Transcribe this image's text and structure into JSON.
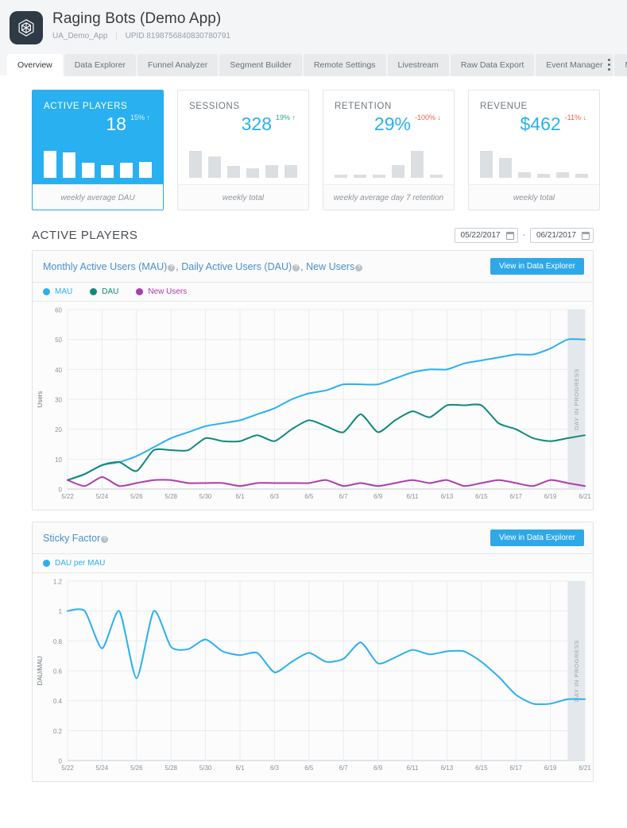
{
  "header": {
    "app_title": "Raging Bots (Demo App)",
    "app_slug": "UA_Demo_App",
    "upid": "UPID 8198756840830780791",
    "logo_icon": "unity-logo-icon",
    "overflow_icon": "kebab-menu-icon"
  },
  "tabs": [
    {
      "label": "Overview",
      "active": true
    },
    {
      "label": "Data Explorer",
      "active": false
    },
    {
      "label": "Funnel Analyzer",
      "active": false
    },
    {
      "label": "Segment Builder",
      "active": false
    },
    {
      "label": "Remote Settings",
      "active": false
    },
    {
      "label": "Livestream",
      "active": false
    },
    {
      "label": "Raw Data Export",
      "active": false
    },
    {
      "label": "Event Manager",
      "active": false
    },
    {
      "label": "More",
      "active": false,
      "caret": "⌄"
    }
  ],
  "kpi_cards": [
    {
      "label": "ACTIVE PLAYERS",
      "value": "18",
      "delta": "15%",
      "delta_dir": "up",
      "arrow": "↑",
      "footer": "weekly average DAU",
      "selected": true,
      "spark": [
        30,
        28,
        17,
        14,
        17,
        18
      ]
    },
    {
      "label": "SESSIONS",
      "value": "328",
      "delta": "19%",
      "delta_dir": "up",
      "arrow": "↑",
      "footer": "weekly total",
      "selected": false,
      "spark": [
        30,
        24,
        13,
        11,
        14,
        14
      ]
    },
    {
      "label": "RETENTION",
      "value": "29%",
      "delta": "-100%",
      "delta_dir": "down",
      "arrow": "↓",
      "footer": "weekly average day 7 retention",
      "selected": false,
      "spark": [
        2,
        2,
        2,
        9,
        19,
        2
      ]
    },
    {
      "label": "REVENUE",
      "value": "$462",
      "delta": "-11%",
      "delta_dir": "down",
      "arrow": "↓",
      "footer": "weekly total",
      "selected": false,
      "spark": [
        26,
        19,
        5,
        4,
        5,
        4
      ]
    }
  ],
  "section": {
    "title": "ACTIVE PLAYERS",
    "date_start": "05/22/2017",
    "date_end": "06/21/2017",
    "date_separator": "-",
    "calendar_icon": "calendar-icon"
  },
  "panels": [
    {
      "title_parts": [
        "Monthly Active Users (MAU)",
        ", Daily Active Users (DAU)",
        ", New Users"
      ],
      "title_plain": "Monthly Active Users (MAU), Daily Active Users (DAU), New Users",
      "button": "View in Data Explorer",
      "in_progress_label": "DAY IN PROGRESS"
    },
    {
      "title_parts": [
        "Sticky Factor"
      ],
      "title_plain": "Sticky Factor",
      "button": "View in Data Explorer",
      "in_progress_label": "DAY IN PROGRESS"
    }
  ],
  "colors": {
    "mau": "#29b0f1",
    "dau": "#0e8a79",
    "new_users": "#ad3cad",
    "accent": "#2fa8e8",
    "up": "#2aa98c",
    "down": "#f0614a"
  },
  "chart_data": [
    {
      "type": "line",
      "title": "Monthly Active Users (MAU), Daily Active Users (DAU), New Users",
      "xlabel": "",
      "ylabel": "Users",
      "ylim": [
        0,
        60
      ],
      "yticks": [
        0,
        10,
        20,
        30,
        40,
        50,
        60
      ],
      "grid": true,
      "legend_position": "top-left",
      "x": [
        "5/22",
        "5/23",
        "5/24",
        "5/25",
        "5/26",
        "5/27",
        "5/28",
        "5/29",
        "5/30",
        "5/31",
        "6/1",
        "6/2",
        "6/3",
        "6/4",
        "6/5",
        "6/6",
        "6/7",
        "6/8",
        "6/9",
        "6/10",
        "6/11",
        "6/12",
        "6/13",
        "6/14",
        "6/15",
        "6/16",
        "6/17",
        "6/18",
        "6/19",
        "6/20",
        "6/21"
      ],
      "xtick_labels": [
        "5/22",
        "5/24",
        "5/26",
        "5/28",
        "5/30",
        "6/1",
        "6/3",
        "6/5",
        "6/7",
        "6/9",
        "6/11",
        "6/13",
        "6/15",
        "6/17",
        "6/19",
        "6/21"
      ],
      "series": [
        {
          "name": "MAU",
          "color": "#29b0f1",
          "values": [
            3,
            5,
            8,
            9,
            11,
            14,
            17,
            19,
            21,
            22,
            23,
            25,
            27,
            30,
            32,
            33,
            35,
            35,
            35,
            37,
            39,
            40,
            40,
            42,
            43,
            44,
            45,
            45,
            47,
            50,
            50
          ]
        },
        {
          "name": "DAU",
          "color": "#0e8a79",
          "values": [
            3,
            5,
            8,
            9,
            6,
            13,
            13,
            13,
            17,
            16,
            16,
            18,
            16,
            20,
            23,
            21,
            19,
            25,
            19,
            23,
            26,
            24,
            28,
            28,
            28,
            22,
            20,
            17,
            16,
            17,
            18
          ]
        },
        {
          "name": "New Users",
          "color": "#ad3cad",
          "values": [
            3,
            1,
            4,
            1,
            2,
            3,
            3,
            2,
            2,
            2,
            1,
            2,
            2,
            2,
            2,
            3,
            1,
            2,
            1,
            2,
            3,
            2,
            3,
            1,
            2,
            3,
            2,
            1,
            3,
            2,
            1
          ]
        }
      ],
      "in_progress_band": {
        "from": "6/20",
        "to": "6/21",
        "label": "DAY IN PROGRESS"
      }
    },
    {
      "type": "line",
      "title": "Sticky Factor",
      "xlabel": "",
      "ylabel": "DAU/MAU",
      "ylim": [
        0,
        1.2
      ],
      "yticks": [
        0,
        0.2,
        0.4,
        0.6,
        0.8,
        1,
        1.2
      ],
      "grid": true,
      "legend_position": "top-left",
      "x": [
        "5/22",
        "5/23",
        "5/24",
        "5/25",
        "5/26",
        "5/27",
        "5/28",
        "5/29",
        "5/30",
        "5/31",
        "6/1",
        "6/2",
        "6/3",
        "6/4",
        "6/5",
        "6/6",
        "6/7",
        "6/8",
        "6/9",
        "6/10",
        "6/11",
        "6/12",
        "6/13",
        "6/14",
        "6/15",
        "6/16",
        "6/17",
        "6/18",
        "6/19",
        "6/20",
        "6/21"
      ],
      "xtick_labels": [
        "5/22",
        "5/24",
        "5/26",
        "5/28",
        "5/30",
        "6/1",
        "6/3",
        "6/5",
        "6/7",
        "6/9",
        "6/11",
        "6/13",
        "6/15",
        "6/17",
        "6/19",
        "6/21"
      ],
      "series": [
        {
          "name": "DAU per MAU",
          "color": "#29b0f1",
          "values": [
            1.0,
            1.0,
            0.75,
            1.0,
            0.55,
            1.0,
            0.76,
            0.745,
            0.81,
            0.73,
            0.705,
            0.72,
            0.59,
            0.66,
            0.72,
            0.66,
            0.68,
            0.79,
            0.65,
            0.69,
            0.74,
            0.71,
            0.73,
            0.73,
            0.66,
            0.56,
            0.44,
            0.38,
            0.38,
            0.41,
            0.41
          ]
        }
      ],
      "in_progress_band": {
        "from": "6/20",
        "to": "6/21",
        "label": "DAY IN PROGRESS"
      }
    }
  ]
}
